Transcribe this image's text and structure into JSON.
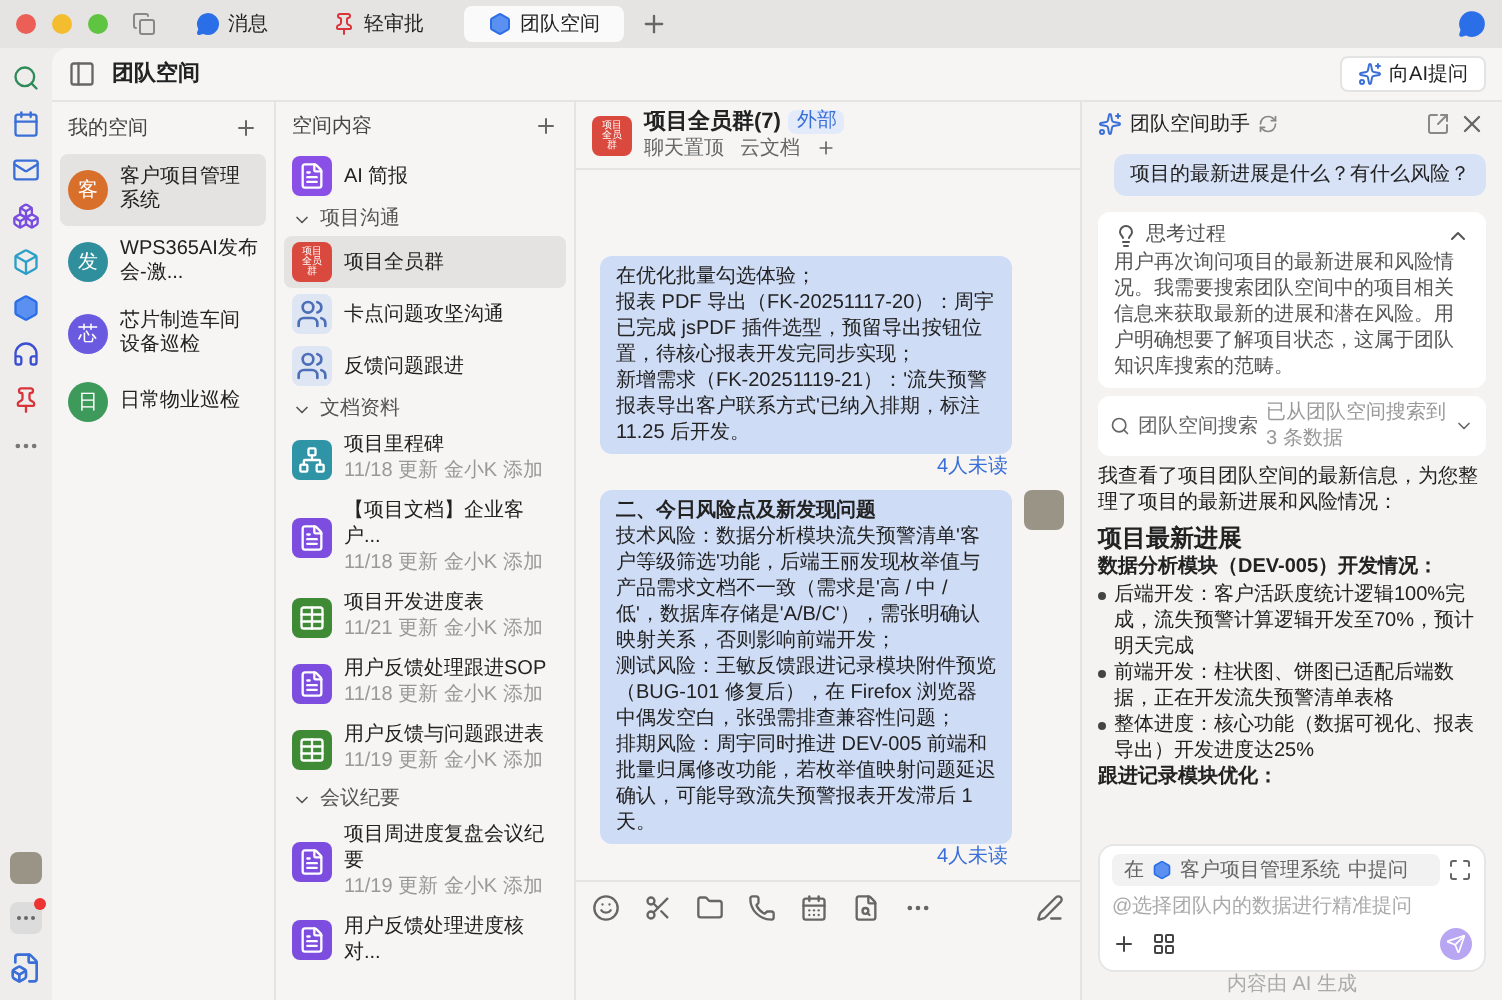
{
  "tabs": [
    {
      "label": "消息",
      "kind": "chat",
      "selected": false
    },
    {
      "label": "轻审批",
      "kind": "pin",
      "selected": false
    },
    {
      "label": "团队空间",
      "kind": "space",
      "selected": true
    }
  ],
  "rail": {
    "more_has_alert": true
  },
  "header": {
    "title": "团队空间",
    "ask_ai_button": "向AI提问"
  },
  "my_spaces": {
    "title": "我的空间",
    "items": [
      {
        "avatar": "客",
        "name": "客户项目管理系统",
        "color": "#d8702c",
        "selected": true
      },
      {
        "avatar": "发",
        "name": "WPS365AI发布会-激...",
        "color": "#2f8f9d",
        "selected": false
      },
      {
        "avatar": "芯",
        "name": "芯片制造车间设备巡检",
        "color": "#6a5ae0",
        "selected": false
      },
      {
        "avatar": "日",
        "name": "日常物业巡检",
        "color": "#3d9a5a",
        "selected": false
      }
    ]
  },
  "space_content": {
    "title": "空间内容",
    "ai_brief": "AI 简报",
    "sections": [
      {
        "title": "项目沟通",
        "expanded": true,
        "items": [
          {
            "kind": "group",
            "name": "项目全员群",
            "icon_text": "项目全员群",
            "selected": true
          },
          {
            "kind": "people",
            "name": "卡点问题攻坚沟通",
            "selected": false
          },
          {
            "kind": "people",
            "name": "反馈问题跟进",
            "selected": false
          }
        ]
      },
      {
        "title": "文档资料",
        "expanded": true,
        "items": [
          {
            "kind": "board",
            "name": "项目里程碑",
            "meta": "11/18 更新 金小K 添加",
            "selected": false
          },
          {
            "kind": "doc",
            "name": "【项目文档】企业客户...",
            "meta": "11/18 更新 金小K 添加",
            "selected": false
          },
          {
            "kind": "sheet",
            "name": "项目开发进度表",
            "meta": "11/21 更新 金小K 添加",
            "selected": false
          },
          {
            "kind": "doc",
            "name": "用户反馈处理跟进SOP",
            "meta": "11/18 更新 金小K 添加",
            "selected": false
          },
          {
            "kind": "sheet",
            "name": "用户反馈与问题跟进表",
            "meta": "11/19 更新 金小K 添加",
            "selected": false
          }
        ]
      },
      {
        "title": "会议纪要",
        "expanded": true,
        "items": [
          {
            "kind": "doc",
            "name": "项目周进度复盘会议纪要",
            "meta": "11/19 更新 金小K 添加",
            "selected": false
          },
          {
            "kind": "doc",
            "name": "用户反馈处理进度核对...",
            "selected": false
          }
        ]
      }
    ]
  },
  "chat": {
    "title": "项目全员群(7)",
    "icon_text": "项目全员群",
    "badge": "外部",
    "tabs": [
      "聊天置顶",
      "云文档"
    ],
    "messages": [
      {
        "lines": [
          "在优化批量勾选体验；",
          "报表 PDF 导出（FK-20251117-20）：周宇已完成 jsPDF 插件选型，预留导出按钮位置，待核心报表开发完同步实现；",
          "新增需求（FK-20251119-21）：'流失预警报表导出客户联系方式'已纳入排期，标注 11.25 后开发。"
        ],
        "read_status": "4人未读",
        "avatar": false
      },
      {
        "title": "二、今日风险点及新发现问题",
        "lines": [
          "技术风险：数据分析模块流失预警清单'客户等级筛选'功能，后端王丽发现枚举值与产品需求文档不一致（需求是'高 / 中 / 低'，数据库存储是'A/B/C'），需张明确认映射关系，否则影响前端开发；",
          "测试风险：王敏反馈跟进记录模块附件预览（BUG-101 修复后），在 Firefox 浏览器中偶发空白，张强需排查兼容性问题；",
          "排期风险：周宇同时推进 DEV-005 前端和批量归属修改功能，若枚举值映射问题延迟确认，可能导致流失预警报表开发滞后 1 天。"
        ],
        "read_status": "4人未读",
        "avatar": true
      }
    ]
  },
  "assistant": {
    "title": "团队空间助手",
    "question": "项目的最新进展是什么？有什么风险？",
    "thinking": {
      "title": "思考过程",
      "expanded": true,
      "text": "用户再次询问项目的最新进展和风险情况。我需要搜索团队空间中的项目相关信息来获取最新的进展和潜在风险。用户明确想要了解项目状态，这属于团队知识库搜索的范畴。"
    },
    "search": {
      "title": "团队空间搜索",
      "result": "已从团队空间搜索到 3 条数据",
      "expanded": false
    },
    "intro": "我查看了项目团队空间的最新信息，为您整理了项目的最新进展和风险情况：",
    "heading": "项目最新进展",
    "subheading": "数据分析模块（DEV-005）开发情况：",
    "bullets": [
      "后端开发：客户活跃度统计逻辑100%完成，流失预警计算逻辑开发至70%，预计明天完成",
      "前端开发：柱状图、饼图已适配后端数据，正在开发流失预警清单表格",
      "整体进度：核心功能（数据可视化、报表导出）开发进度达25%"
    ],
    "subheading_2": "跟进记录模块优化：",
    "input": {
      "scope_prefix": "在",
      "scope_name": "客户项目管理系统",
      "scope_suffix": "中提问",
      "placeholder": "@选择团队内的数据进行精准提问"
    },
    "footer": "内容由 AI 生成"
  }
}
